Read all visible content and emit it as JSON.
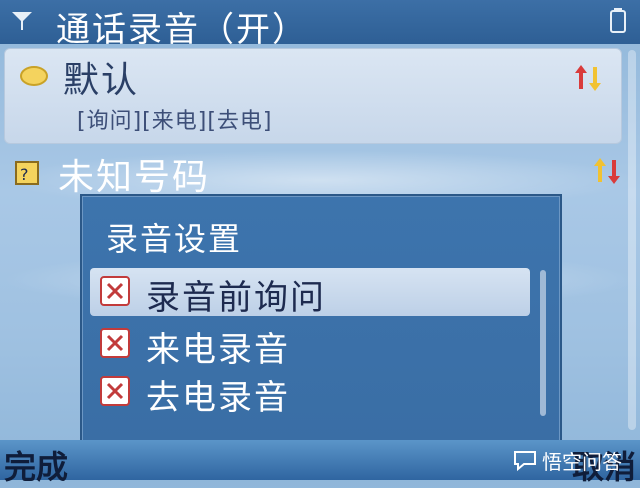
{
  "titlebar": {
    "title": "通话录音（开）"
  },
  "list": {
    "items": [
      {
        "title": "默认",
        "subtitle": "[询问][来电][去电]"
      },
      {
        "title": "未知号码",
        "subtitle": ""
      }
    ]
  },
  "popup": {
    "title": "录音设置",
    "options": [
      {
        "label": "录音前询问",
        "checked": true
      },
      {
        "label": "来电录音",
        "checked": true
      },
      {
        "label": "去电录音",
        "checked": true
      }
    ]
  },
  "softkeys": {
    "left": "完成",
    "right": "取消"
  },
  "watermark": {
    "text": "悟空问答"
  },
  "colors": {
    "titlebar": "#2e5f95",
    "popup": "#3a6ea5",
    "selected_row": "#c7d7ea",
    "checkbox_border": "#c23b3b"
  }
}
